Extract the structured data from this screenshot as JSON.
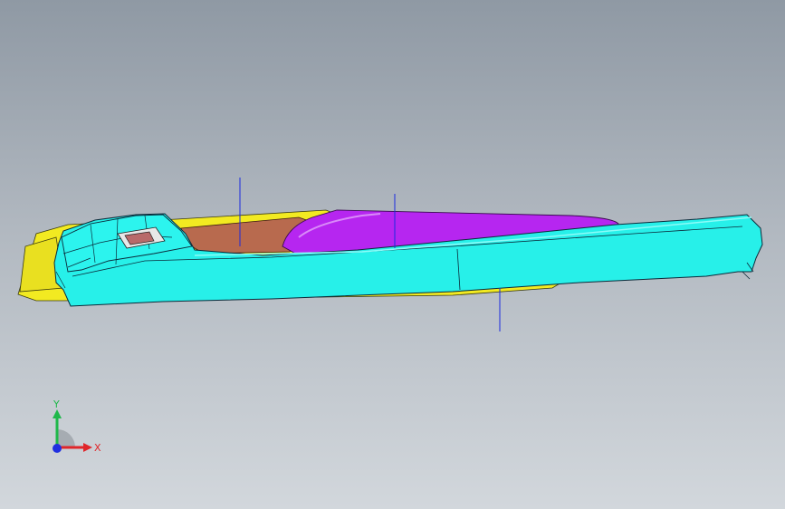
{
  "viewport": {
    "background_top": "#8f99a4",
    "background_bottom": "#d2d7dc"
  },
  "model": {
    "body_color": "#27f0e9",
    "lid_color": "#b626f0",
    "base_color": "#f2ea21",
    "cavity_color": "#b86a4e",
    "edge_color": "#0b2a3a"
  },
  "triad": {
    "x_label": "X",
    "y_label": "Y",
    "x_color": "#e0262a",
    "y_color": "#1fb84a",
    "z_color": "#2030e0"
  }
}
